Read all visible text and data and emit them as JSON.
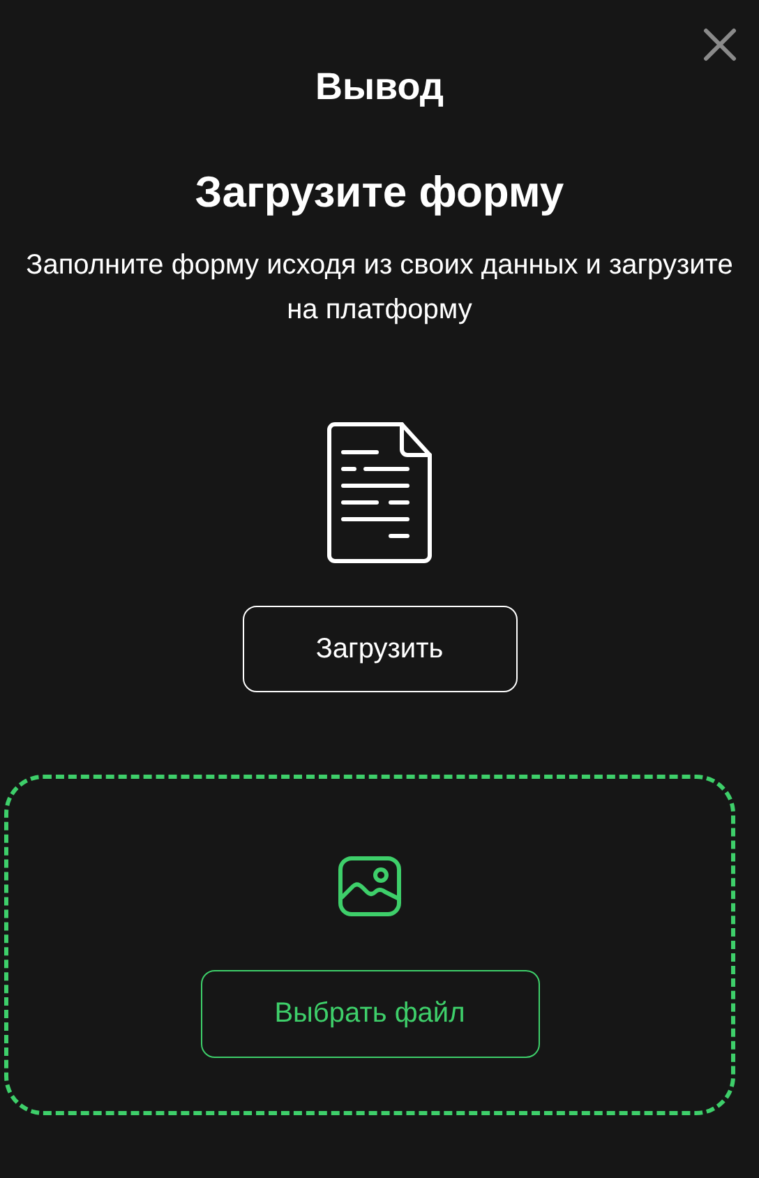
{
  "window": {
    "title": "Вывод"
  },
  "upload_form": {
    "heading": "Загрузите форму",
    "description": "Заполните форму исходя из своих данных и загрузите на платформу",
    "button": "Загрузить"
  },
  "dropzone": {
    "button": "Выбрать файл"
  }
}
